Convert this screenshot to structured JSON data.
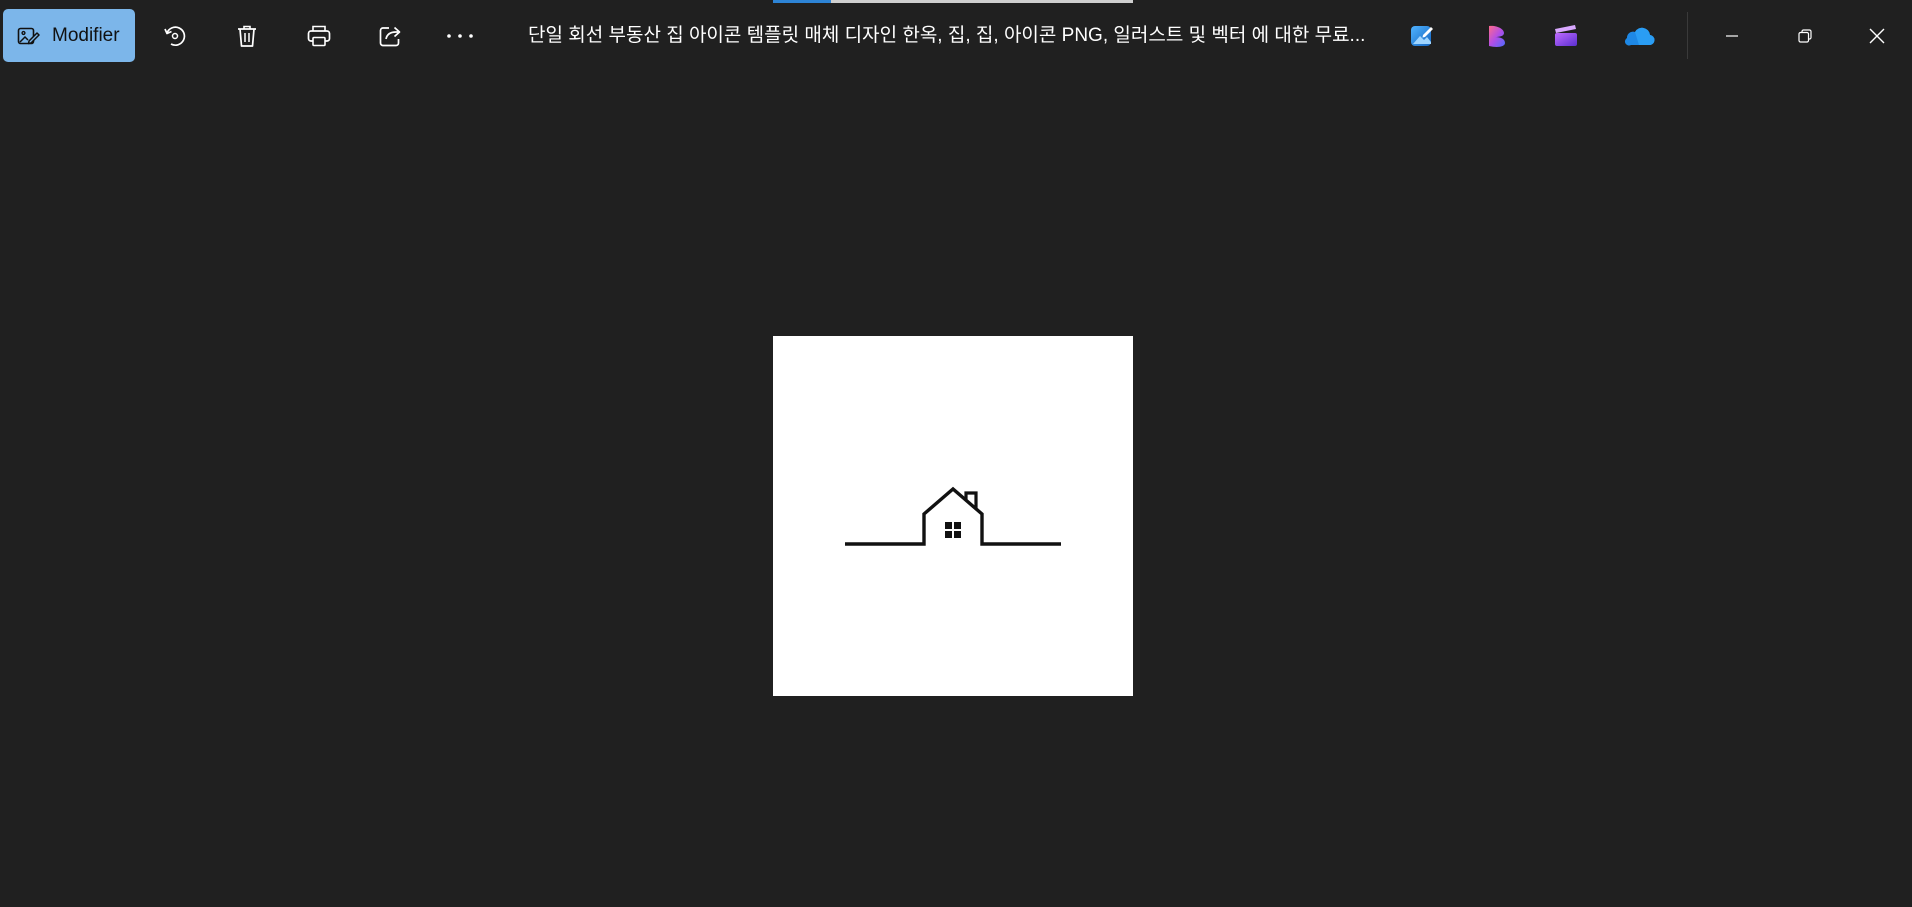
{
  "toolbar": {
    "edit_label": "Modifier",
    "buttons": [
      "rotate-icon",
      "delete-icon",
      "print-icon",
      "share-icon",
      "more-icon"
    ],
    "more_glyph": "···"
  },
  "title": "단일 회선 부동산 집 아이콘 템플릿 매체   디자인 한옥, 집, 집, 아이콘 PNG, 일러스트 및 벡터 에 대한 무료...",
  "apps": [
    "photo-editor-icon",
    "clipchamp-icon",
    "video-editor-icon",
    "onedrive-icon"
  ],
  "window_controls": [
    "minimize-icon",
    "restore-icon",
    "close-icon"
  ],
  "loading_progress": 0.16,
  "image": {
    "alt": "house icon with horizon line",
    "background": "#ffffff",
    "stroke": "#111111"
  },
  "colors": {
    "background": "#202020",
    "accent": "#7cb6ea",
    "progress": "#2d84d6"
  }
}
